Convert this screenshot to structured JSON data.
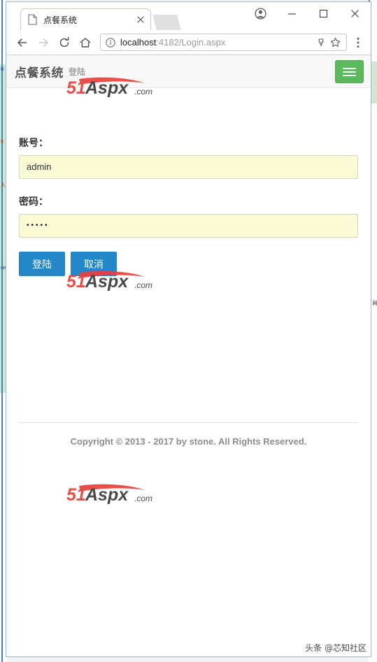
{
  "browser": {
    "tab": {
      "title": "点餐系统",
      "favicon_icon": "page-icon",
      "close_icon": "close-icon"
    },
    "window_controls": {
      "profile_icon": "profile-avatar-icon",
      "minimize_icon": "minimize-icon",
      "maximize_icon": "maximize-icon",
      "close_icon": "close-icon"
    },
    "toolbar": {
      "back_icon": "back-arrow-icon",
      "forward_icon": "forward-arrow-icon",
      "reload_icon": "reload-icon",
      "home_icon": "home-icon",
      "info_icon": "info-circle-icon",
      "url_host": "localhost",
      "url_rest": ":4182/Login.aspx",
      "url_full": "localhost:4182/Login.aspx",
      "save_icon": "save-page-icon",
      "bookmark_icon": "star-icon",
      "menu_icon": "three-dot-menu-icon"
    }
  },
  "app": {
    "navbar": {
      "brand": "点餐系统",
      "subtitle": "登陆",
      "toggle_icon": "hamburger-menu-icon",
      "toggle_color": "#5cb85c"
    },
    "form": {
      "account_label": "账号：",
      "account_value": "admin",
      "password_label": "密码：",
      "password_value": "•••••",
      "submit_label": "登陆",
      "cancel_label": "取消",
      "button_color": "#2387c8",
      "input_background": "#fbfbd6"
    },
    "footer": {
      "copyright": "Copyright © 2013 - 2017 by stone. All Rights Reserved."
    }
  },
  "watermark": {
    "prefix": "51",
    "word": "Aspx",
    "suffix": ".com",
    "prefix_color": "#e8403a",
    "word_color": "#3a3a3a"
  },
  "attribution": {
    "text": "头条 @芯知社区"
  },
  "background_scraps": {
    "left": [
      "B",
      "5",
      "人",
      "ue"
    ],
    "right": [
      "网"
    ]
  }
}
